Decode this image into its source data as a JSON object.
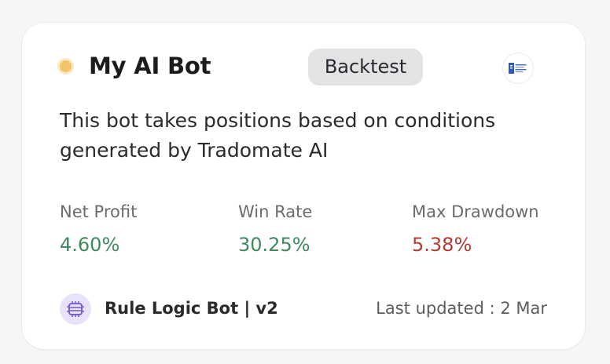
{
  "card": {
    "status_color": "#f2c469",
    "bot_name": "My AI Bot",
    "mode_badge": "Backtest",
    "broker_logo_icon": "broker-logo-icon",
    "description": "This bot takes positions based on conditions generated by Tradomate AI"
  },
  "metrics": [
    {
      "label": "Net Profit",
      "value": "4.60%",
      "color": "#3e8a5c"
    },
    {
      "label": "Win Rate",
      "value": "30.25%",
      "color": "#3e8a5c"
    },
    {
      "label": "Max Drawdown",
      "value": "5.38%",
      "color": "#b23a33"
    }
  ],
  "footer": {
    "strategy_icon": "strategy-chip-icon",
    "strategy_name": "Rule Logic Bot | v2",
    "last_updated": "Last updated : 2 Mar"
  },
  "colors": {
    "positive": "#3e8a5c",
    "negative": "#b23a33",
    "badge_bg": "#e3e3e6",
    "icon_bg": "#e9e2fb",
    "icon_fg": "#7b5fd6"
  }
}
